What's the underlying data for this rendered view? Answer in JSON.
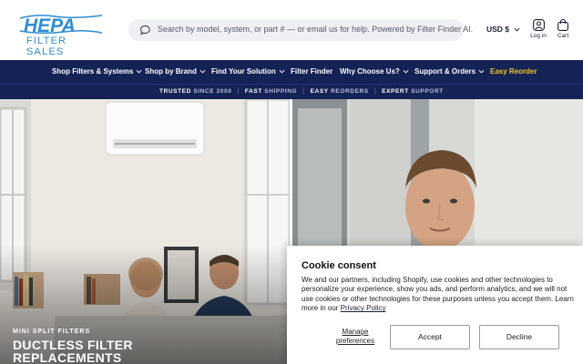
{
  "logo": {
    "text": "HEPA",
    "sub": "FILTER SALES",
    "color": "#2f8bd3"
  },
  "search": {
    "placeholder": "Search by model, system, or part # — or email us for help. Powered by Filter Finder AI."
  },
  "currency": {
    "label": "USD $"
  },
  "account": {
    "login_label": "Log in",
    "cart_label": "Cart"
  },
  "nav": {
    "items": [
      {
        "label": "Shop Filters & Systems",
        "dropdown": true
      },
      {
        "label": "Shop by Brand",
        "dropdown": true
      },
      {
        "label": "Find Your Solution",
        "dropdown": true
      },
      {
        "label": "Filter Finder",
        "dropdown": false
      },
      {
        "label": "Why Choose Us?",
        "dropdown": true
      },
      {
        "label": "Support & Orders",
        "dropdown": true
      },
      {
        "label": "Easy Reorder",
        "dropdown": false
      }
    ]
  },
  "trust": {
    "items": [
      {
        "strong": "TRUSTED",
        "rest": "SINCE 2000"
      },
      {
        "strong": "FAST",
        "rest": "SHIPPING"
      },
      {
        "strong": "EASY",
        "rest": "REORDERS"
      },
      {
        "strong": "EXPERT",
        "rest": "SUPPORT"
      }
    ]
  },
  "hero": {
    "tag": "MINI SPLIT FILTERS",
    "title_line1": "DUCTLESS FILTER",
    "title_line2": "REPLACEMENTS"
  },
  "cookie": {
    "title": "Cookie consent",
    "body": "We and our partners, including Shopify, use cookies and other technologies to personalize your experience, show you ads, and perform analytics, and we will not use cookies or other technologies for these purposes unless you accept them. Learn more in our",
    "link": "Privacy Policy",
    "manage_line1": "Manage",
    "manage_line2": "preferences",
    "accept": "Accept",
    "decline": "Decline"
  },
  "colors": {
    "nav_bg": "#142255",
    "accent": "#f5c518",
    "brand_blue": "#2f8bd3"
  }
}
